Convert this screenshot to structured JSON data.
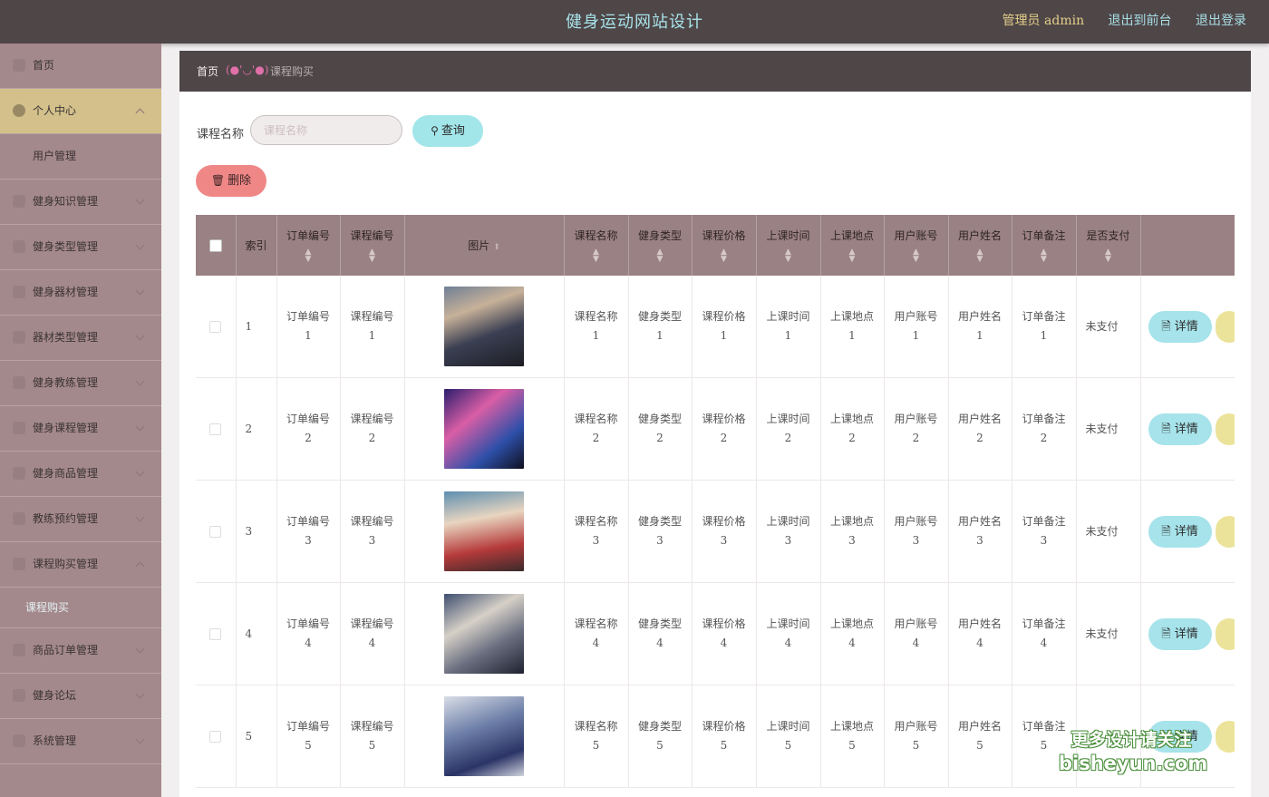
{
  "header": {
    "title": "健身运动网站设计",
    "admin": "管理员 admin",
    "back_to_front": "退出到前台",
    "logout": "退出登录"
  },
  "sidebar": {
    "items": [
      {
        "label": "首页",
        "icon": "home-icon"
      },
      {
        "label": "个人中心",
        "icon": "user-icon",
        "active": true
      },
      {
        "label": "用户管理",
        "sub": true
      },
      {
        "label": "健身知识管理",
        "icon": "knowledge-icon"
      },
      {
        "label": "健身类型管理",
        "icon": "type-icon"
      },
      {
        "label": "健身器材管理",
        "icon": "equipment-icon"
      },
      {
        "label": "器材类型管理",
        "icon": "category-icon"
      },
      {
        "label": "健身教练管理",
        "icon": "coach-icon"
      },
      {
        "label": "健身课程管理",
        "icon": "course-icon"
      },
      {
        "label": "健身商品管理",
        "icon": "goods-icon"
      },
      {
        "label": "教练预约管理",
        "icon": "booking-icon"
      },
      {
        "label": "课程购买管理",
        "icon": "purchase-icon"
      },
      {
        "label": "课程购买",
        "selected": true
      },
      {
        "label": "商品订单管理",
        "icon": "order-icon"
      },
      {
        "label": "健身论坛",
        "icon": "forum-icon"
      },
      {
        "label": "系统管理",
        "icon": "system-icon"
      }
    ]
  },
  "breadcrumb": {
    "home": "首页",
    "face": "(●'◡'●)",
    "current": "课程购买"
  },
  "search": {
    "label": "课程名称",
    "placeholder": "课程名称",
    "query_button": "查询"
  },
  "actions": {
    "delete_button": "删除"
  },
  "table": {
    "headers": {
      "index": "索引",
      "order_no": "订单编号",
      "course_no": "课程编号",
      "image": "图片",
      "course_name": "课程名称",
      "fitness_type": "健身类型",
      "price": "课程价格",
      "time": "上课时间",
      "place": "上课地点",
      "account": "用户账号",
      "username": "用户姓名",
      "remark": "订单备注",
      "paid": "是否支付"
    },
    "detail_button": "详情",
    "rows": [
      {
        "index": "1",
        "order_no": "订单编号",
        "course_no": "课程编号",
        "course_name": "课程名称",
        "fitness_type": "健身类型",
        "price": "课程价格",
        "time": "上课时间",
        "place": "上课地点",
        "account": "用户账号",
        "username": "用户姓名",
        "remark": "订单备注",
        "num": "1",
        "paid": "未支付"
      },
      {
        "index": "2",
        "order_no": "订单编号",
        "course_no": "课程编号",
        "course_name": "课程名称",
        "fitness_type": "健身类型",
        "price": "课程价格",
        "time": "上课时间",
        "place": "上课地点",
        "account": "用户账号",
        "username": "用户姓名",
        "remark": "订单备注",
        "num": "2",
        "paid": "未支付"
      },
      {
        "index": "3",
        "order_no": "订单编号",
        "course_no": "课程编号",
        "course_name": "课程名称",
        "fitness_type": "健身类型",
        "price": "课程价格",
        "time": "上课时间",
        "place": "上课地点",
        "account": "用户账号",
        "username": "用户姓名",
        "remark": "订单备注",
        "num": "3",
        "paid": "未支付"
      },
      {
        "index": "4",
        "order_no": "订单编号",
        "course_no": "课程编号",
        "course_name": "课程名称",
        "fitness_type": "健身类型",
        "price": "课程价格",
        "time": "上课时间",
        "place": "上课地点",
        "account": "用户账号",
        "username": "用户姓名",
        "remark": "订单备注",
        "num": "4",
        "paid": "未支付"
      },
      {
        "index": "5",
        "order_no": "订单编号",
        "course_no": "课程编号",
        "course_name": "课程名称",
        "fitness_type": "健身类型",
        "price": "课程价格",
        "time": "上课时间",
        "place": "上课地点",
        "account": "用户账号",
        "username": "用户姓名",
        "remark": "订单备注",
        "num": "5",
        "paid": ""
      }
    ]
  },
  "watermark": {
    "line1": "更多设计请关注",
    "line2": "bisheyun.com"
  },
  "colors": {
    "header_bg": "#4f4648",
    "sidebar_bg": "#a4898c",
    "sidebar_active": "#d3c08b",
    "table_header_bg": "#9a8183",
    "query_button": "#a2e6ea",
    "delete_button": "#f08787"
  }
}
